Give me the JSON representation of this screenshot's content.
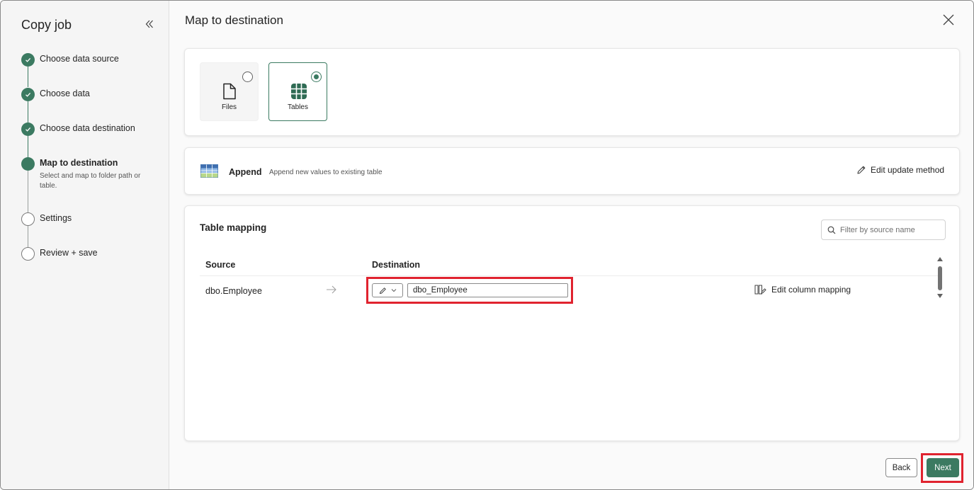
{
  "sidebar": {
    "title": "Copy job",
    "steps": [
      {
        "label": "Choose data source",
        "status": "done"
      },
      {
        "label": "Choose data",
        "status": "done"
      },
      {
        "label": "Choose data destination",
        "status": "done"
      },
      {
        "label": "Map to destination",
        "status": "active",
        "sub": "Select and map to folder path or table."
      },
      {
        "label": "Settings",
        "status": "todo"
      },
      {
        "label": "Review + save",
        "status": "todo"
      }
    ]
  },
  "main": {
    "title": "Map to destination",
    "type_options": [
      {
        "label": "Files",
        "selected": false
      },
      {
        "label": "Tables",
        "selected": true
      }
    ],
    "update_method": {
      "title": "Append",
      "description": "Append new values to existing table",
      "edit_label": "Edit update method"
    },
    "table_mapping": {
      "title": "Table mapping",
      "filter_placeholder": "Filter by source name",
      "columns": {
        "source": "Source",
        "destination": "Destination"
      },
      "rows": [
        {
          "source": "dbo.Employee",
          "destination": "dbo_Employee",
          "action": "Edit column mapping"
        }
      ]
    }
  },
  "footer": {
    "back_label": "Back",
    "next_label": "Next"
  },
  "colors": {
    "accent": "#3b7a61",
    "highlight": "#e0232f"
  }
}
